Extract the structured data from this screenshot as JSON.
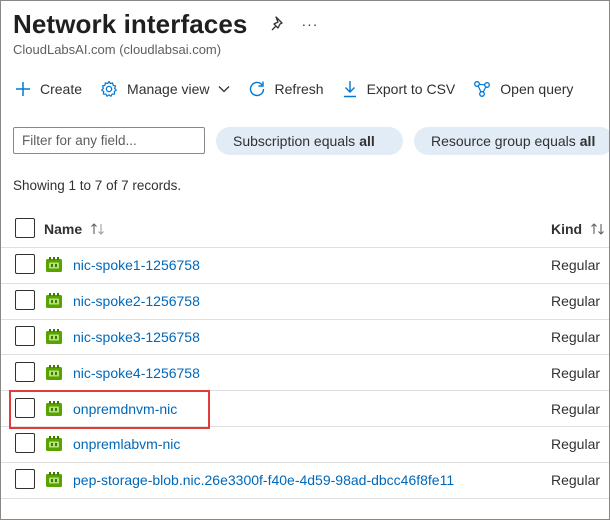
{
  "header": {
    "title": "Network interfaces",
    "subtitle": "CloudLabsAI.com (cloudlabsai.com)",
    "more_label": "···"
  },
  "toolbar": {
    "create": "Create",
    "manage_view": "Manage view",
    "refresh": "Refresh",
    "export_csv": "Export to CSV",
    "open_query": "Open query"
  },
  "filters": {
    "search_placeholder": "Filter for any field...",
    "subscription_prefix": "Subscription equals",
    "subscription_value": "all",
    "resource_group_prefix": "Resource group equals",
    "resource_group_value": "all"
  },
  "records_text": "Showing 1 to 7 of 7 records.",
  "table": {
    "columns": {
      "name": "Name",
      "kind": "Kind"
    },
    "rows": [
      {
        "name": "nic-spoke1-1256758",
        "kind": "Regular"
      },
      {
        "name": "nic-spoke2-1256758",
        "kind": "Regular"
      },
      {
        "name": "nic-spoke3-1256758",
        "kind": "Regular"
      },
      {
        "name": "nic-spoke4-1256758",
        "kind": "Regular"
      },
      {
        "name": "onpremdnvm-nic",
        "kind": "Regular"
      },
      {
        "name": "onpremlabvm-nic",
        "kind": "Regular"
      },
      {
        "name": "pep-storage-blob.nic.26e3300f-f40e-4d59-98ad-dbcc46f8fe11",
        "kind": "Regular"
      }
    ]
  },
  "colors": {
    "link": "#0068b8",
    "accent": "#0078d4",
    "pill_bg": "#e1ecf7",
    "highlight": "#e03c3c",
    "nic_icon": "#57a300"
  },
  "icons": [
    "pin-icon",
    "add-icon",
    "gear-icon",
    "chevron-down-icon",
    "refresh-icon",
    "download-icon",
    "query-icon",
    "sort-icon",
    "network-interface-icon"
  ]
}
